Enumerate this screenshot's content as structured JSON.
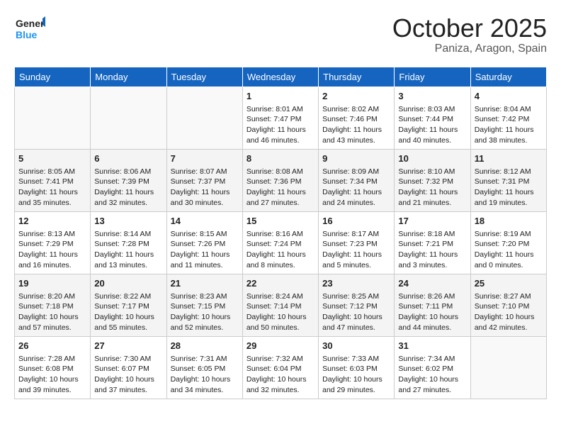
{
  "header": {
    "logo_general": "General",
    "logo_blue": "Blue",
    "title": "October 2025",
    "subtitle": "Paniza, Aragon, Spain"
  },
  "weekdays": [
    "Sunday",
    "Monday",
    "Tuesday",
    "Wednesday",
    "Thursday",
    "Friday",
    "Saturday"
  ],
  "weeks": [
    [
      {
        "day": "",
        "info": ""
      },
      {
        "day": "",
        "info": ""
      },
      {
        "day": "",
        "info": ""
      },
      {
        "day": "1",
        "info": "Sunrise: 8:01 AM\nSunset: 7:47 PM\nDaylight: 11 hours and 46 minutes."
      },
      {
        "day": "2",
        "info": "Sunrise: 8:02 AM\nSunset: 7:46 PM\nDaylight: 11 hours and 43 minutes."
      },
      {
        "day": "3",
        "info": "Sunrise: 8:03 AM\nSunset: 7:44 PM\nDaylight: 11 hours and 40 minutes."
      },
      {
        "day": "4",
        "info": "Sunrise: 8:04 AM\nSunset: 7:42 PM\nDaylight: 11 hours and 38 minutes."
      }
    ],
    [
      {
        "day": "5",
        "info": "Sunrise: 8:05 AM\nSunset: 7:41 PM\nDaylight: 11 hours and 35 minutes."
      },
      {
        "day": "6",
        "info": "Sunrise: 8:06 AM\nSunset: 7:39 PM\nDaylight: 11 hours and 32 minutes."
      },
      {
        "day": "7",
        "info": "Sunrise: 8:07 AM\nSunset: 7:37 PM\nDaylight: 11 hours and 30 minutes."
      },
      {
        "day": "8",
        "info": "Sunrise: 8:08 AM\nSunset: 7:36 PM\nDaylight: 11 hours and 27 minutes."
      },
      {
        "day": "9",
        "info": "Sunrise: 8:09 AM\nSunset: 7:34 PM\nDaylight: 11 hours and 24 minutes."
      },
      {
        "day": "10",
        "info": "Sunrise: 8:10 AM\nSunset: 7:32 PM\nDaylight: 11 hours and 21 minutes."
      },
      {
        "day": "11",
        "info": "Sunrise: 8:12 AM\nSunset: 7:31 PM\nDaylight: 11 hours and 19 minutes."
      }
    ],
    [
      {
        "day": "12",
        "info": "Sunrise: 8:13 AM\nSunset: 7:29 PM\nDaylight: 11 hours and 16 minutes."
      },
      {
        "day": "13",
        "info": "Sunrise: 8:14 AM\nSunset: 7:28 PM\nDaylight: 11 hours and 13 minutes."
      },
      {
        "day": "14",
        "info": "Sunrise: 8:15 AM\nSunset: 7:26 PM\nDaylight: 11 hours and 11 minutes."
      },
      {
        "day": "15",
        "info": "Sunrise: 8:16 AM\nSunset: 7:24 PM\nDaylight: 11 hours and 8 minutes."
      },
      {
        "day": "16",
        "info": "Sunrise: 8:17 AM\nSunset: 7:23 PM\nDaylight: 11 hours and 5 minutes."
      },
      {
        "day": "17",
        "info": "Sunrise: 8:18 AM\nSunset: 7:21 PM\nDaylight: 11 hours and 3 minutes."
      },
      {
        "day": "18",
        "info": "Sunrise: 8:19 AM\nSunset: 7:20 PM\nDaylight: 11 hours and 0 minutes."
      }
    ],
    [
      {
        "day": "19",
        "info": "Sunrise: 8:20 AM\nSunset: 7:18 PM\nDaylight: 10 hours and 57 minutes."
      },
      {
        "day": "20",
        "info": "Sunrise: 8:22 AM\nSunset: 7:17 PM\nDaylight: 10 hours and 55 minutes."
      },
      {
        "day": "21",
        "info": "Sunrise: 8:23 AM\nSunset: 7:15 PM\nDaylight: 10 hours and 52 minutes."
      },
      {
        "day": "22",
        "info": "Sunrise: 8:24 AM\nSunset: 7:14 PM\nDaylight: 10 hours and 50 minutes."
      },
      {
        "day": "23",
        "info": "Sunrise: 8:25 AM\nSunset: 7:12 PM\nDaylight: 10 hours and 47 minutes."
      },
      {
        "day": "24",
        "info": "Sunrise: 8:26 AM\nSunset: 7:11 PM\nDaylight: 10 hours and 44 minutes."
      },
      {
        "day": "25",
        "info": "Sunrise: 8:27 AM\nSunset: 7:10 PM\nDaylight: 10 hours and 42 minutes."
      }
    ],
    [
      {
        "day": "26",
        "info": "Sunrise: 7:28 AM\nSunset: 6:08 PM\nDaylight: 10 hours and 39 minutes."
      },
      {
        "day": "27",
        "info": "Sunrise: 7:30 AM\nSunset: 6:07 PM\nDaylight: 10 hours and 37 minutes."
      },
      {
        "day": "28",
        "info": "Sunrise: 7:31 AM\nSunset: 6:05 PM\nDaylight: 10 hours and 34 minutes."
      },
      {
        "day": "29",
        "info": "Sunrise: 7:32 AM\nSunset: 6:04 PM\nDaylight: 10 hours and 32 minutes."
      },
      {
        "day": "30",
        "info": "Sunrise: 7:33 AM\nSunset: 6:03 PM\nDaylight: 10 hours and 29 minutes."
      },
      {
        "day": "31",
        "info": "Sunrise: 7:34 AM\nSunset: 6:02 PM\nDaylight: 10 hours and 27 minutes."
      },
      {
        "day": "",
        "info": ""
      }
    ]
  ]
}
